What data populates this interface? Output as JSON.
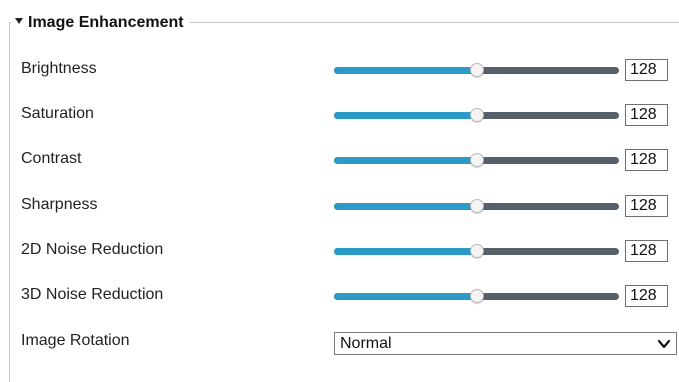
{
  "section": {
    "title": "Image Enhancement",
    "collapse_icon": "triangle-down-icon"
  },
  "sliders": [
    {
      "label": "Brightness",
      "value": "128",
      "level": 0.5
    },
    {
      "label": "Saturation",
      "value": "128",
      "level": 0.5
    },
    {
      "label": "Contrast",
      "value": "128",
      "level": 0.5
    },
    {
      "label": "Sharpness",
      "value": "128",
      "level": 0.5
    },
    {
      "label": "2D Noise Reduction",
      "value": "128",
      "level": 0.5
    },
    {
      "label": "3D Noise Reduction",
      "value": "128",
      "level": 0.5
    }
  ],
  "rotation": {
    "label": "Image Rotation",
    "selected": "Normal",
    "icon": "chevron-down-icon"
  },
  "colors": {
    "track_fill": "#2a9bc6",
    "track_empty": "#55606b"
  }
}
